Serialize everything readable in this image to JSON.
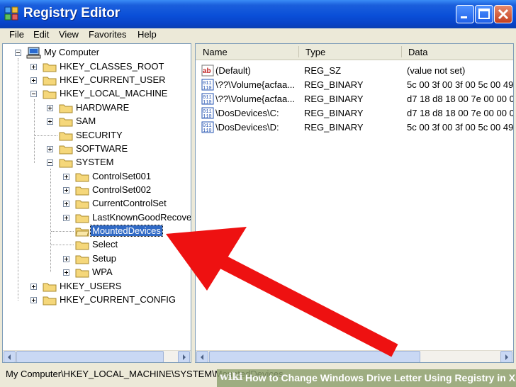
{
  "window": {
    "title": "Registry Editor"
  },
  "menu": [
    "File",
    "Edit",
    "View",
    "Favorites",
    "Help"
  ],
  "tree": [
    {
      "label": "My Computer"
    },
    {
      "label": "HKEY_CLASSES_ROOT"
    },
    {
      "label": "HKEY_CURRENT_USER"
    },
    {
      "label": "HKEY_LOCAL_MACHINE"
    },
    {
      "label": "HARDWARE"
    },
    {
      "label": "SAM"
    },
    {
      "label": "SECURITY"
    },
    {
      "label": "SOFTWARE"
    },
    {
      "label": "SYSTEM"
    },
    {
      "label": "ControlSet001"
    },
    {
      "label": "ControlSet002"
    },
    {
      "label": "CurrentControlSet"
    },
    {
      "label": "LastKnownGoodRecove"
    },
    {
      "label": "MountedDevices"
    },
    {
      "label": "Select"
    },
    {
      "label": "Setup"
    },
    {
      "label": "WPA"
    },
    {
      "label": "HKEY_USERS"
    },
    {
      "label": "HKEY_CURRENT_CONFIG"
    }
  ],
  "columns": [
    "Name",
    "Type",
    "Data"
  ],
  "values": [
    {
      "name": "(Default)",
      "type": "REG_SZ",
      "data": "(value not set)",
      "icon": "string-value-icon"
    },
    {
      "name": "\\??\\Volume{acfaa...",
      "type": "REG_BINARY",
      "data": "5c 00 3f 00 3f 00 5c 00 49",
      "icon": "binary-value-icon"
    },
    {
      "name": "\\??\\Volume{acfaa...",
      "type": "REG_BINARY",
      "data": "d7 18 d8 18 00 7e 00 00 0(",
      "icon": "binary-value-icon"
    },
    {
      "name": "\\DosDevices\\C:",
      "type": "REG_BINARY",
      "data": "d7 18 d8 18 00 7e 00 00 0(",
      "icon": "binary-value-icon"
    },
    {
      "name": "\\DosDevices\\D:",
      "type": "REG_BINARY",
      "data": "5c 00 3f 00 3f 00 5c 00 49",
      "icon": "binary-value-icon"
    }
  ],
  "status": "My Computer\\HKEY_LOCAL_MACHINE\\SYSTEM\\MountedDevices",
  "caption": {
    "brand": "wiki",
    "text": "How to Change Windows Drive Letter Using Registry in Xp"
  },
  "colors": {
    "titlebar": "#0a4fd8",
    "selection": "#316ac5",
    "arrow": "#ee1111"
  }
}
